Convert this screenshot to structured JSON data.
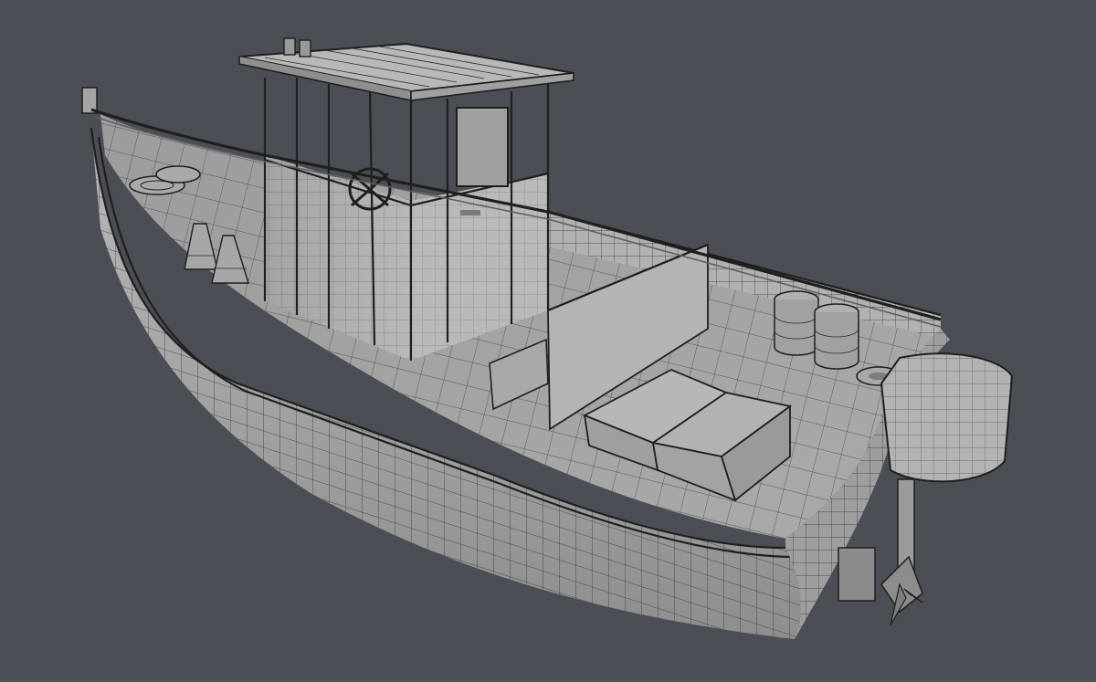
{
  "scene": {
    "subject": "boat-wireframe-render",
    "background_color": "#4b4f55",
    "surface_color": "#a9a9a9",
    "wire_color": "#2b2b2b"
  }
}
